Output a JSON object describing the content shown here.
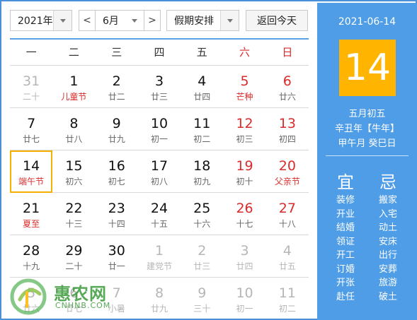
{
  "toolbar": {
    "year": "2021年",
    "month": "6月",
    "prev": "<",
    "next": ">",
    "holiday": "假期安排",
    "today": "返回今天"
  },
  "weekdays": [
    "一",
    "二",
    "三",
    "四",
    "五",
    "六",
    "日"
  ],
  "weeks": [
    [
      {
        "d": "31",
        "s": "二十",
        "other": true
      },
      {
        "d": "1",
        "s": "儿童节",
        "fest": true
      },
      {
        "d": "2",
        "s": "廿二"
      },
      {
        "d": "3",
        "s": "廿三"
      },
      {
        "d": "4",
        "s": "廿四"
      },
      {
        "d": "5",
        "s": "芒种",
        "fest": true,
        "weekend": true
      },
      {
        "d": "6",
        "s": "廿六",
        "weekend": true
      }
    ],
    [
      {
        "d": "7",
        "s": "廿七"
      },
      {
        "d": "8",
        "s": "廿八"
      },
      {
        "d": "9",
        "s": "廿九"
      },
      {
        "d": "10",
        "s": "初一"
      },
      {
        "d": "11",
        "s": "初二"
      },
      {
        "d": "12",
        "s": "初三",
        "weekend": true
      },
      {
        "d": "13",
        "s": "初四",
        "weekend": true
      }
    ],
    [
      {
        "d": "14",
        "s": "端午节",
        "fest": true,
        "selected": true
      },
      {
        "d": "15",
        "s": "初六"
      },
      {
        "d": "16",
        "s": "初七"
      },
      {
        "d": "17",
        "s": "初八"
      },
      {
        "d": "18",
        "s": "初九"
      },
      {
        "d": "19",
        "s": "初十",
        "weekend": true
      },
      {
        "d": "20",
        "s": "父亲节",
        "fest": true,
        "weekend": true
      }
    ],
    [
      {
        "d": "21",
        "s": "夏至",
        "fest": true
      },
      {
        "d": "22",
        "s": "十三"
      },
      {
        "d": "23",
        "s": "十四"
      },
      {
        "d": "24",
        "s": "十五"
      },
      {
        "d": "25",
        "s": "十六"
      },
      {
        "d": "26",
        "s": "十七",
        "weekend": true
      },
      {
        "d": "27",
        "s": "十八",
        "weekend": true
      }
    ],
    [
      {
        "d": "28",
        "s": "十九"
      },
      {
        "d": "29",
        "s": "二十"
      },
      {
        "d": "30",
        "s": "廿一"
      },
      {
        "d": "1",
        "s": "建党节",
        "other": true
      },
      {
        "d": "2",
        "s": "廿三",
        "other": true
      },
      {
        "d": "3",
        "s": "廿四",
        "other": true
      },
      {
        "d": "4",
        "s": "廿五",
        "other": true
      }
    ],
    [
      {
        "d": "5",
        "s": "廿六",
        "other": true
      },
      {
        "d": "6",
        "s": "廿七",
        "other": true
      },
      {
        "d": "7",
        "s": "小暑",
        "other": true
      },
      {
        "d": "8",
        "s": "廿九",
        "other": true
      },
      {
        "d": "9",
        "s": "三十",
        "other": true
      },
      {
        "d": "10",
        "s": "初一",
        "other": true
      },
      {
        "d": "11",
        "s": "初二",
        "other": true
      }
    ]
  ],
  "panel": {
    "date": "2021-06-14",
    "day": "14",
    "lunar": "五月初五",
    "ganzhi_year": "辛丑年【牛年】",
    "ganzhi_day": "甲午月 癸巳日",
    "yi_title": "宜",
    "ji_title": "忌",
    "yi": [
      "装修",
      "开业",
      "结婚",
      "领证",
      "开工",
      "订婚",
      "开张",
      "赴任"
    ],
    "ji": [
      "搬家",
      "入宅",
      "动土",
      "安床",
      "出行",
      "安葬",
      "旅游",
      "破土"
    ]
  },
  "watermark": {
    "brand": "惠农网",
    "url": "CNHNB.COM"
  },
  "colors": {
    "accent": "#4f9de6",
    "highlight": "#ffb400",
    "holiday_red": "#d92b2b"
  }
}
